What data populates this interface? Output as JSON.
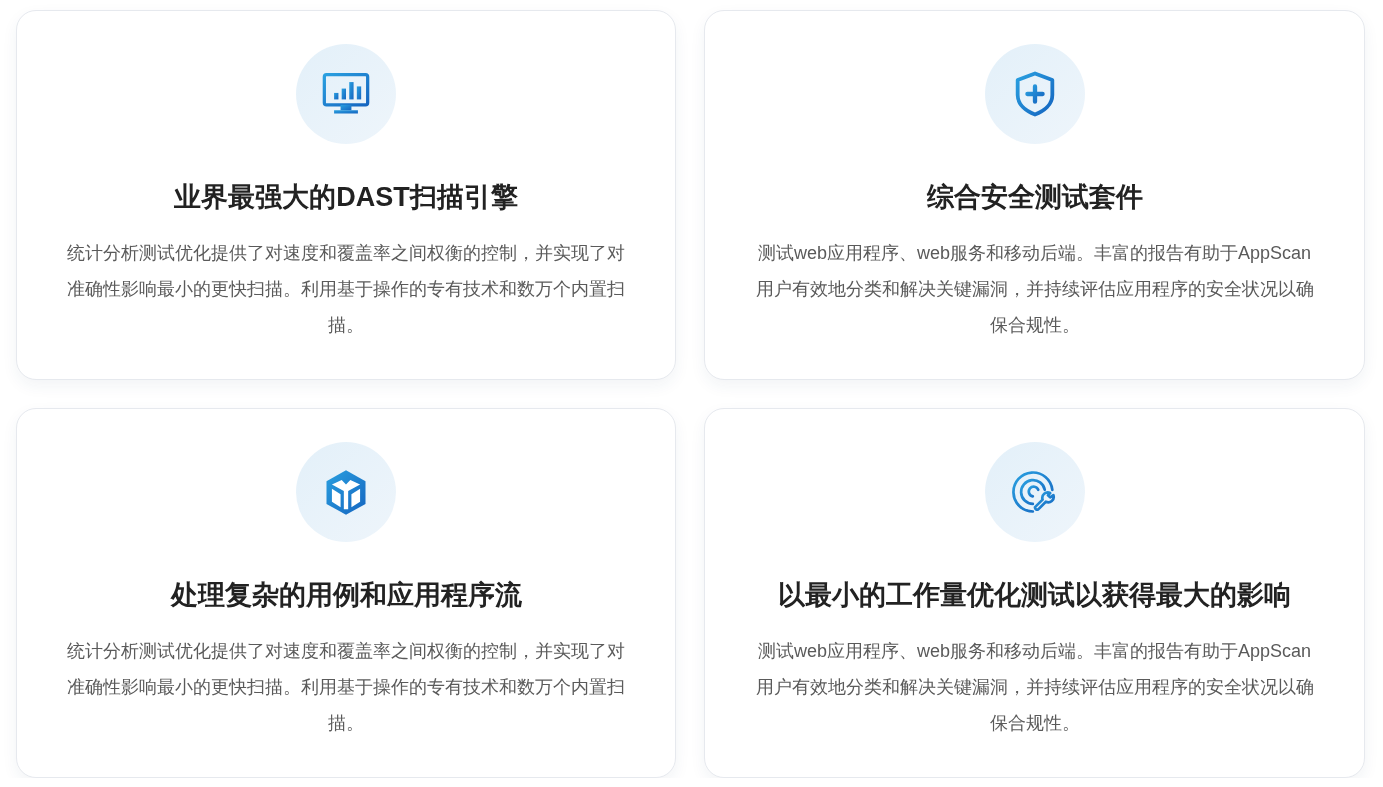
{
  "cards": [
    {
      "title": "业界最强大的DAST扫描引擎",
      "text": "统计分析测试优化提供了对速度和覆盖率之间权衡的控制，并实现了对准确性影响最小的更快扫描。利用基于操作的专有技术和数万个内置扫描。"
    },
    {
      "title": "综合安全测试套件",
      "text": "测试web应用程序、web服务和移动后端。丰富的报告有助于AppScan用户有效地分类和解决关键漏洞，并持续评估应用程序的安全状况以确保合规性。"
    },
    {
      "title": "处理复杂的用例和应用程序流",
      "text": "统计分析测试优化提供了对速度和覆盖率之间权衡的控制，并实现了对准确性影响最小的更快扫描。利用基于操作的专有技术和数万个内置扫描。"
    },
    {
      "title": "以最小的工作量优化测试以获得最大的影响",
      "text": "测试web应用程序、web服务和移动后端。丰富的报告有助于AppScan用户有效地分类和解决关键漏洞，并持续评估应用程序的安全状况以确保合规性。"
    }
  ]
}
